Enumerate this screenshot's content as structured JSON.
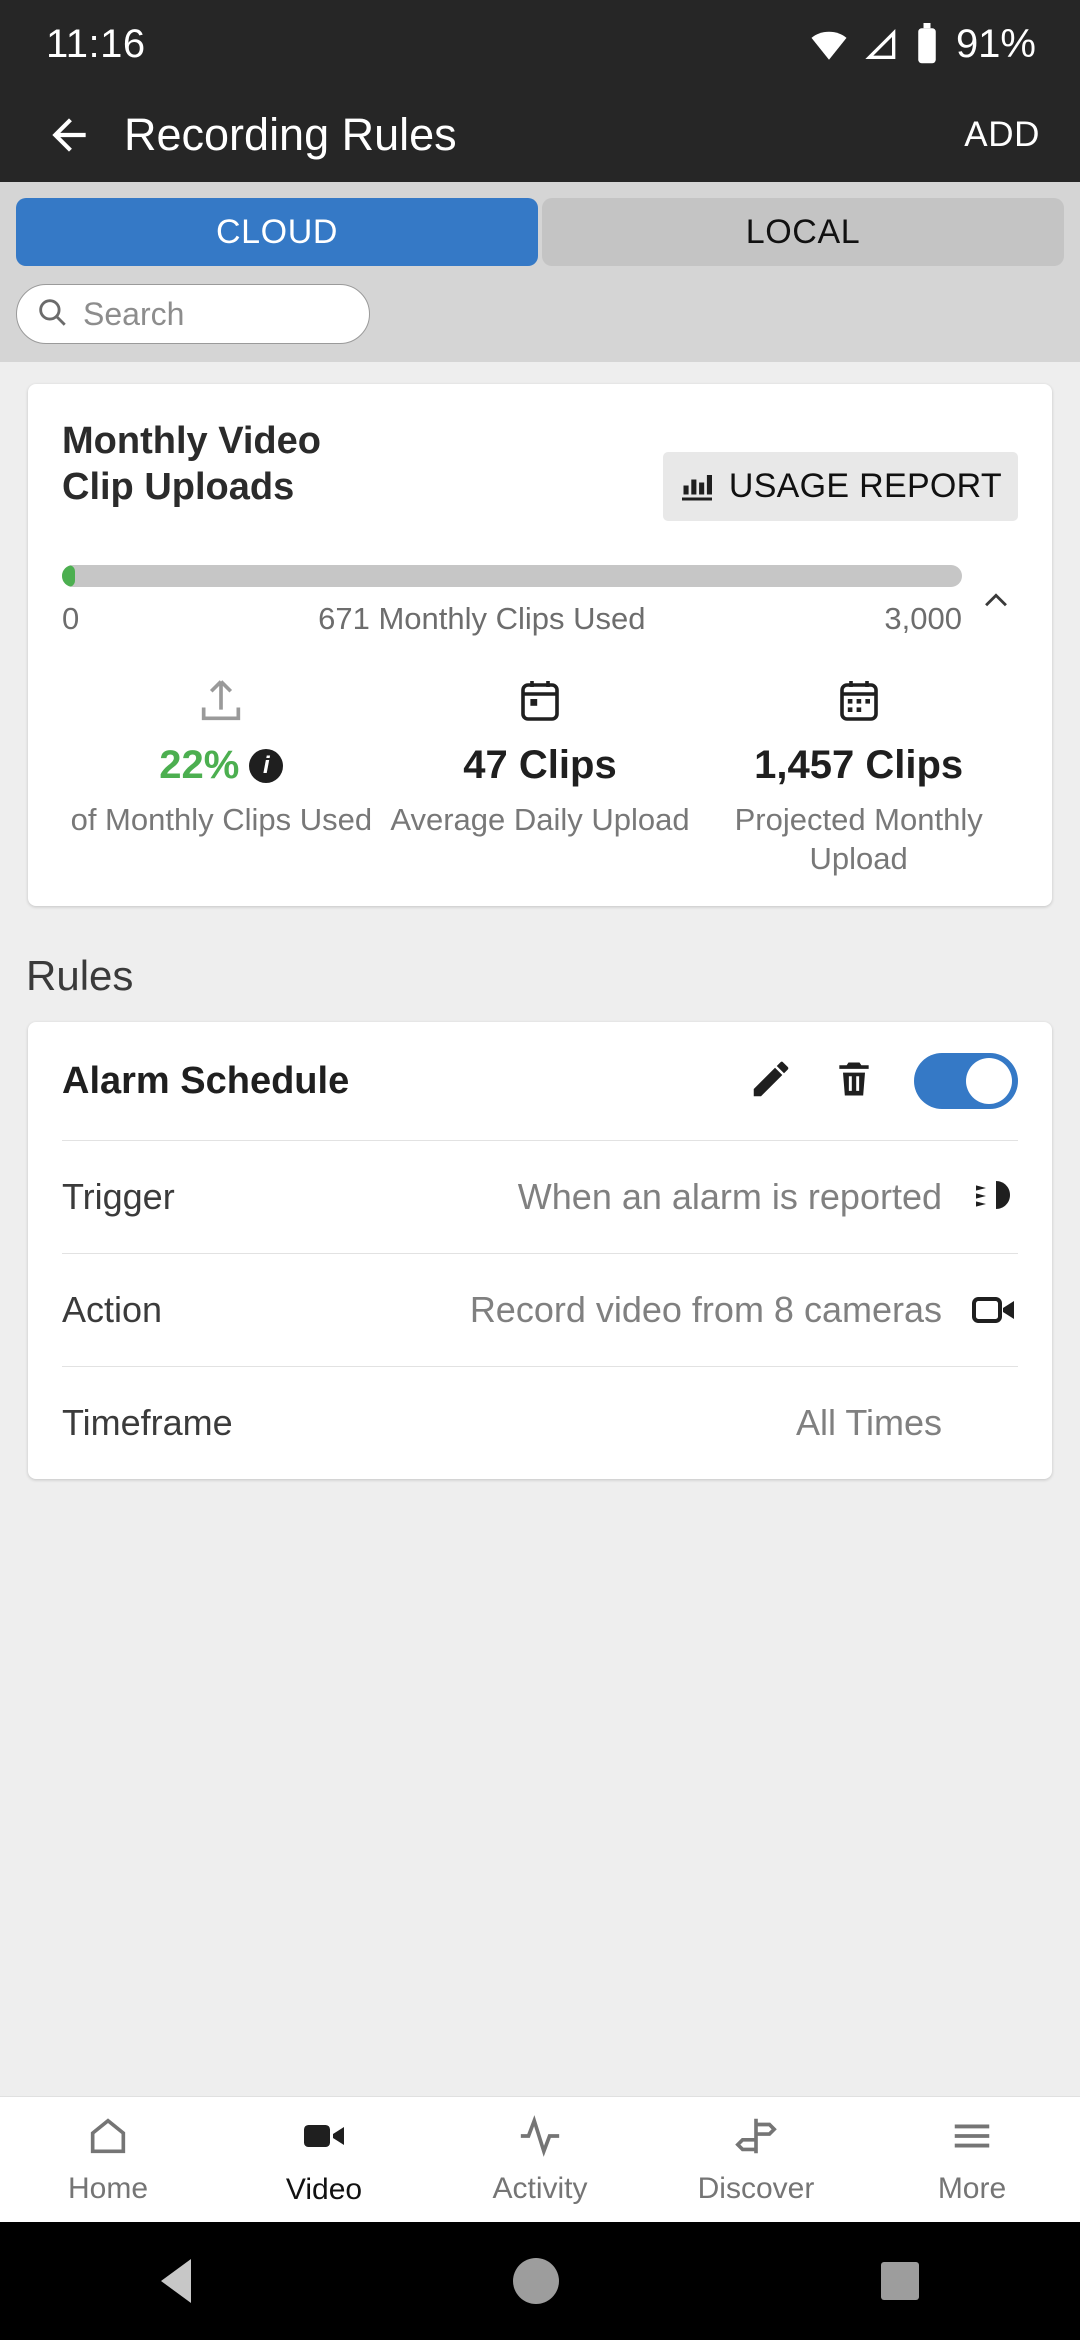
{
  "status_bar": {
    "time": "11:16",
    "battery_percent": "91%",
    "icons": [
      "wifi-icon",
      "cellular-signal-icon",
      "battery-icon"
    ]
  },
  "app_bar": {
    "back_icon": "back-arrow-icon",
    "title": "Recording Rules",
    "action_label": "ADD"
  },
  "tabs": [
    {
      "label": "CLOUD",
      "selected": true
    },
    {
      "label": "LOCAL",
      "selected": false
    }
  ],
  "search": {
    "icon": "search-icon",
    "placeholder": "Search",
    "value": ""
  },
  "usage_card": {
    "title": "Monthly Video Clip Uploads",
    "report_button": {
      "icon": "bar-chart-icon",
      "label": "USAGE REPORT"
    },
    "progress": {
      "min_label": "0",
      "center_label": "671 Monthly Clips Used",
      "max_label": "3,000",
      "used": 671,
      "total": 3000,
      "percent": 22,
      "fill_color": "#4caf50",
      "track_color": "#c6c6c6",
      "collapse_icon": "chevron-up-icon"
    },
    "stats": [
      {
        "icon": "upload-icon",
        "value": "22%",
        "value_color": "#4caf50",
        "has_info": true,
        "label": "of Monthly Clips Used"
      },
      {
        "icon": "calendar-day-icon",
        "value": "47 Clips",
        "value_color": "#1f1f1f",
        "has_info": false,
        "label": "Average Daily Upload"
      },
      {
        "icon": "calendar-month-icon",
        "value": "1,457 Clips",
        "value_color": "#1f1f1f",
        "has_info": false,
        "label": "Projected Monthly Upload"
      }
    ]
  },
  "rules_section": {
    "heading": "Rules",
    "rule": {
      "name": "Alarm Schedule",
      "edit_icon": "pencil-icon",
      "delete_icon": "trash-icon",
      "enabled": true,
      "toggle_color": "#3579c6",
      "rows": [
        {
          "key": "Trigger",
          "value": "When an alarm is reported",
          "icon": "alarm-siren-icon"
        },
        {
          "key": "Action",
          "value": "Record video from 8 cameras",
          "icon": "video-camera-icon"
        },
        {
          "key": "Timeframe",
          "value": "All Times",
          "icon": ""
        }
      ]
    }
  },
  "bottom_nav": [
    {
      "label": "Home",
      "icon": "home-icon",
      "active": false
    },
    {
      "label": "Video",
      "icon": "video-camera-icon",
      "active": true
    },
    {
      "label": "Activity",
      "icon": "activity-pulse-icon",
      "active": false
    },
    {
      "label": "Discover",
      "icon": "discover-signpost-icon",
      "active": false
    },
    {
      "label": "More",
      "icon": "menu-lines-icon",
      "active": false
    }
  ],
  "system_nav": {
    "back": "system-back-icon",
    "home": "system-home-icon",
    "recents": "system-recents-icon"
  }
}
